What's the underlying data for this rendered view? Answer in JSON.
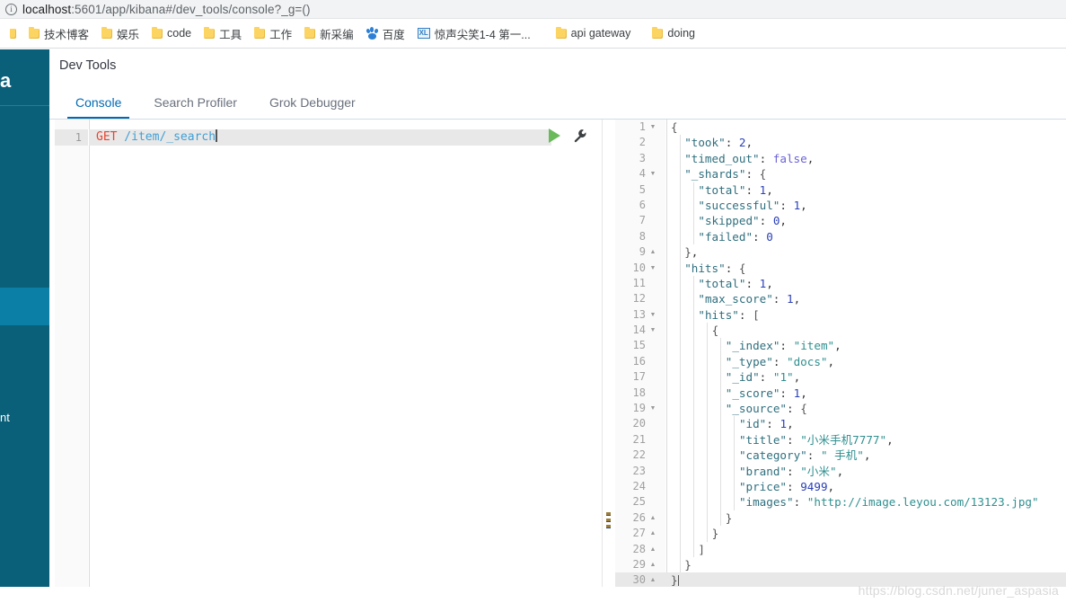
{
  "browser": {
    "info_icon": "info-icon",
    "url_scheme_host": "localhost",
    "url_rest": ":5601/app/kibana#/dev_tools/console?_g=()",
    "bookmarks": [
      {
        "label": "技术博客",
        "icon": "folder-icon"
      },
      {
        "label": "娱乐",
        "icon": "folder-icon"
      },
      {
        "label": "code",
        "icon": "folder-icon"
      },
      {
        "label": "工具",
        "icon": "folder-icon"
      },
      {
        "label": "工作",
        "icon": "folder-icon"
      },
      {
        "label": "新采编",
        "icon": "folder-icon"
      },
      {
        "label": "百度",
        "icon": "baidu-icon"
      },
      {
        "label": "惊声尖笑1-4 第一...",
        "icon": "xunlei-icon"
      },
      {
        "label": "api gateway",
        "icon": "folder-icon"
      },
      {
        "label": "doing",
        "icon": "folder-icon"
      }
    ]
  },
  "sidebar": {
    "logo_text": "a",
    "management_label": "nt",
    "bg_color": "#0a5f79",
    "active_color": "#0b7fa5"
  },
  "header": {
    "title": "Dev Tools",
    "tabs": [
      {
        "label": "Console",
        "active": true
      },
      {
        "label": "Search Profiler",
        "active": false
      },
      {
        "label": "Grok Debugger",
        "active": false
      }
    ],
    "accent_color": "#006bb4"
  },
  "request": {
    "line_number": "1",
    "method": "GET",
    "path": " /item/_search",
    "play_icon": "play-icon",
    "wrench_icon": "wrench-icon"
  },
  "response": {
    "lines": [
      {
        "n": "1",
        "fold": "▼",
        "depth": 0,
        "text": "{"
      },
      {
        "n": "2",
        "fold": "",
        "depth": 1,
        "text": "  \"took\": 2,"
      },
      {
        "n": "3",
        "fold": "",
        "depth": 1,
        "text": "  \"timed_out\": false,"
      },
      {
        "n": "4",
        "fold": "▼",
        "depth": 1,
        "text": "  \"_shards\": {"
      },
      {
        "n": "5",
        "fold": "",
        "depth": 2,
        "text": "    \"total\": 1,"
      },
      {
        "n": "6",
        "fold": "",
        "depth": 2,
        "text": "    \"successful\": 1,"
      },
      {
        "n": "7",
        "fold": "",
        "depth": 2,
        "text": "    \"skipped\": 0,"
      },
      {
        "n": "8",
        "fold": "",
        "depth": 2,
        "text": "    \"failed\": 0"
      },
      {
        "n": "9",
        "fold": "▲",
        "depth": 1,
        "text": "  },"
      },
      {
        "n": "10",
        "fold": "▼",
        "depth": 1,
        "text": "  \"hits\": {"
      },
      {
        "n": "11",
        "fold": "",
        "depth": 2,
        "text": "    \"total\": 1,"
      },
      {
        "n": "12",
        "fold": "",
        "depth": 2,
        "text": "    \"max_score\": 1,"
      },
      {
        "n": "13",
        "fold": "▼",
        "depth": 2,
        "text": "    \"hits\": ["
      },
      {
        "n": "14",
        "fold": "▼",
        "depth": 3,
        "text": "      {"
      },
      {
        "n": "15",
        "fold": "",
        "depth": 4,
        "text": "        \"_index\": \"item\","
      },
      {
        "n": "16",
        "fold": "",
        "depth": 4,
        "text": "        \"_type\": \"docs\","
      },
      {
        "n": "17",
        "fold": "",
        "depth": 4,
        "text": "        \"_id\": \"1\","
      },
      {
        "n": "18",
        "fold": "",
        "depth": 4,
        "text": "        \"_score\": 1,"
      },
      {
        "n": "19",
        "fold": "▼",
        "depth": 4,
        "text": "        \"_source\": {"
      },
      {
        "n": "20",
        "fold": "",
        "depth": 5,
        "text": "          \"id\": 1,"
      },
      {
        "n": "21",
        "fold": "",
        "depth": 5,
        "text": "          \"title\": \"小米手机7777\","
      },
      {
        "n": "22",
        "fold": "",
        "depth": 5,
        "text": "          \"category\": \" 手机\","
      },
      {
        "n": "23",
        "fold": "",
        "depth": 5,
        "text": "          \"brand\": \"小米\","
      },
      {
        "n": "24",
        "fold": "",
        "depth": 5,
        "text": "          \"price\": 9499,"
      },
      {
        "n": "25",
        "fold": "",
        "depth": 5,
        "text": "          \"images\": \"http://image.leyou.com/13123.jpg\""
      },
      {
        "n": "26",
        "fold": "▲",
        "depth": 4,
        "text": "        }"
      },
      {
        "n": "27",
        "fold": "▲",
        "depth": 3,
        "text": "      }"
      },
      {
        "n": "28",
        "fold": "▲",
        "depth": 2,
        "text": "    ]"
      },
      {
        "n": "29",
        "fold": "▲",
        "depth": 1,
        "text": "  }"
      },
      {
        "n": "30",
        "fold": "▲",
        "depth": 0,
        "text": "}",
        "highlight": true
      }
    ]
  },
  "watermark": "https://blog.csdn.net/juner_aspasia"
}
